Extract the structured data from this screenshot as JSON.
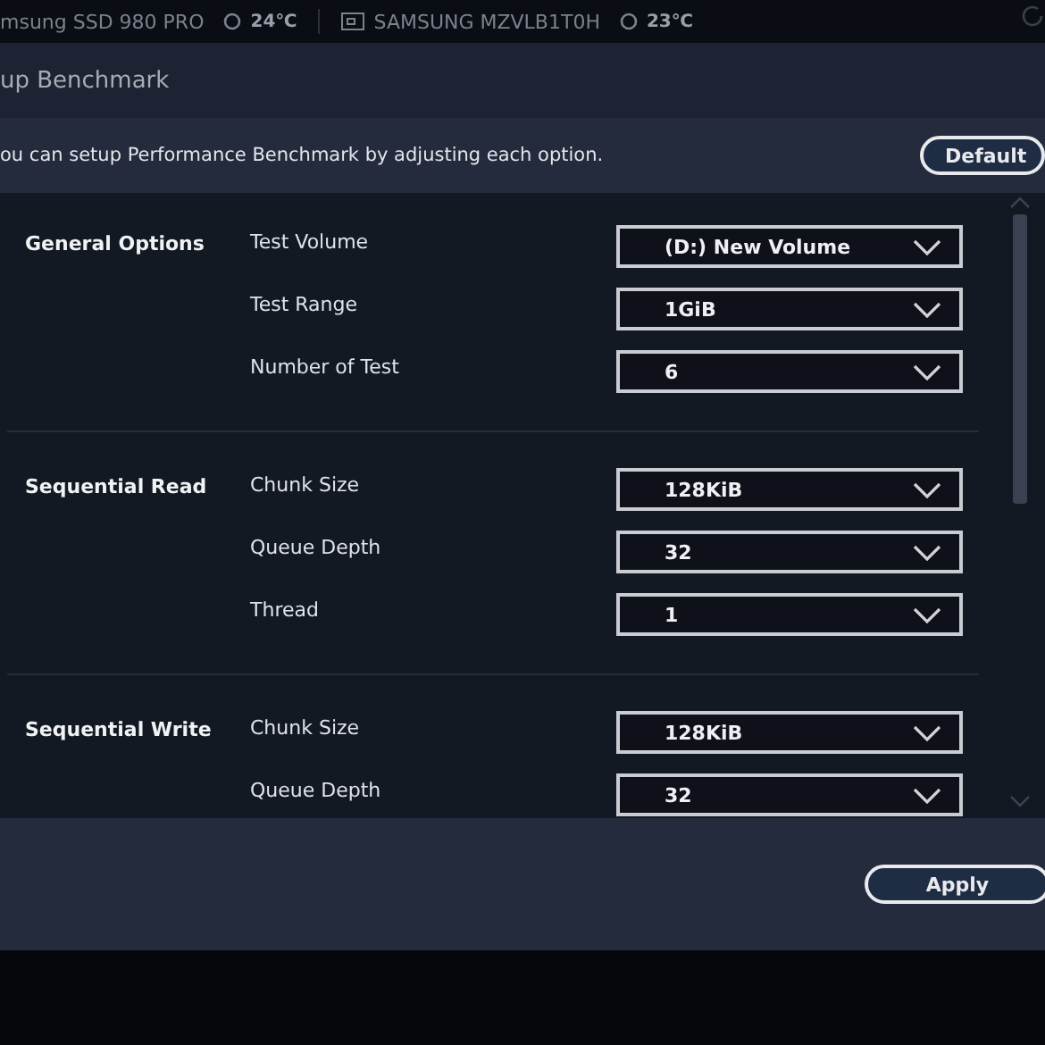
{
  "status_bar": {
    "drives": [
      {
        "name": "msung SSD 980 PRO",
        "temperature": "24℃",
        "kind": "partial"
      },
      {
        "name": "SAMSUNG MZVLB1T0H",
        "temperature": "23℃",
        "kind": "drive"
      }
    ]
  },
  "dialog": {
    "title": "up Benchmark",
    "description": "ou can setup Performance Benchmark by adjusting each option.",
    "default_button": "Default",
    "sections": [
      {
        "label": "General Options",
        "options": [
          {
            "label": "Test Volume",
            "value": "(D:) New Volume"
          },
          {
            "label": "Test Range",
            "value": "1GiB"
          },
          {
            "label": "Number of Test",
            "value": "6"
          }
        ]
      },
      {
        "label": "Sequential Read",
        "options": [
          {
            "label": "Chunk Size",
            "value": "128KiB"
          },
          {
            "label": "Queue Depth",
            "value": "32"
          },
          {
            "label": "Thread",
            "value": "1"
          }
        ]
      },
      {
        "label": "Sequential Write",
        "options": [
          {
            "label": "Chunk Size",
            "value": "128KiB"
          },
          {
            "label": "Queue Depth",
            "value": "32"
          }
        ]
      }
    ],
    "apply_button": "Apply"
  }
}
